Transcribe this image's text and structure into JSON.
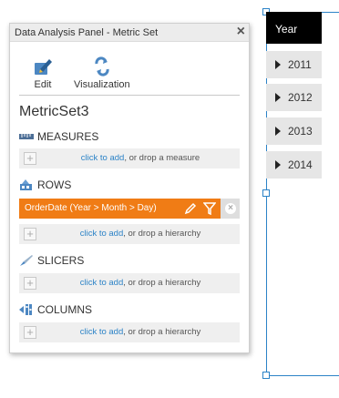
{
  "panel": {
    "title": "Data Analysis Panel - Metric Set",
    "close_glyph": "×",
    "tools": [
      {
        "label": "Edit",
        "icon": "edit-icon"
      },
      {
        "label": "Visualization",
        "icon": "visualization-icon"
      }
    ],
    "metric_set_name": "MetricSet3",
    "sections": {
      "measures": {
        "title": "MEASURES",
        "icon": "measures-icon",
        "link": "click to add",
        "rest": ", or drop a measure"
      },
      "rows": {
        "title": "ROWS",
        "icon": "rows-icon",
        "item": "OrderDate (Year > Month > Day)",
        "link": "click to add",
        "rest": ", or drop a hierarchy"
      },
      "slicers": {
        "title": "SLICERS",
        "icon": "slicers-icon",
        "link": "click to add",
        "rest": ", or drop a hierarchy"
      },
      "columns": {
        "title": "COLUMNS",
        "icon": "columns-icon",
        "link": "click to add",
        "rest": ", or drop a hierarchy"
      }
    },
    "plus_glyph": "+",
    "remove_glyph": "×"
  },
  "pivot": {
    "header": "Year",
    "rows": [
      "2011",
      "2012",
      "2013",
      "2014"
    ]
  },
  "colors": {
    "accent": "#2c83c7",
    "row_item": "#f07c15",
    "header_bg": "#000000"
  }
}
